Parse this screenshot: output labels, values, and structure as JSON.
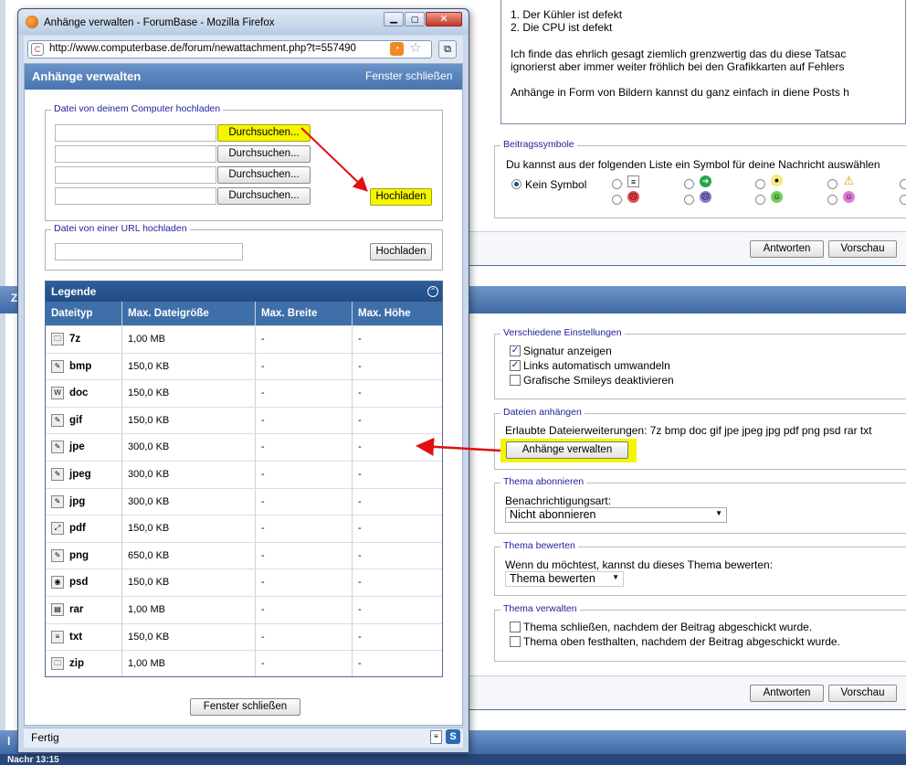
{
  "background_page": {
    "post_lines": [
      "1. Der Kühler ist defekt",
      "2. Die CPU ist defekt",
      "Ich finde das ehrlich gesagt ziemlich grenzwertig das du diese Tatsac",
      "ignorierst aber immer weiter fröhlich bei den Grafikkarten auf Fehlers",
      "Anhänge in Form von Bildern kannst du ganz einfach in diene Posts h"
    ],
    "beitragssymbole": {
      "legend": "Beitragssymbole",
      "text": "Du kannst aus der folgenden Liste ein Symbol für deine Nachricht auswählen",
      "none_label": "Kein Symbol"
    },
    "reply_button": "Antworten",
    "preview_button": "Vorschau",
    "section_letter": "Z",
    "verschiedene": {
      "legend": "Verschiedene Einstellungen",
      "items": [
        {
          "label": "Signatur anzeigen",
          "checked": "✓"
        },
        {
          "label": "Links automatisch umwandeln",
          "checked": "✓"
        },
        {
          "label": "Grafische Smileys deaktivieren",
          "checked": ""
        }
      ]
    },
    "dateien": {
      "legend": "Dateien anhängen",
      "text": "Erlaubte Dateierweiterungen: 7z bmp doc gif jpe jpeg jpg pdf png psd rar txt",
      "button": "Anhänge verwalten"
    },
    "abonnieren": {
      "legend": "Thema abonnieren",
      "label": "Benachrichtigungsart:",
      "value": "Nicht abonnieren"
    },
    "bewerten": {
      "legend": "Thema bewerten",
      "label": "Wenn du möchtest, kannst du dieses Thema bewerten:",
      "value": "Thema bewerten"
    },
    "verwalten": {
      "legend": "Thema verwalten",
      "items": [
        "Thema schließen, nachdem der Beitrag abgeschickt wurde.",
        "Thema oben festhalten, nachdem der Beitrag abgeschickt wurde."
      ]
    },
    "bottom_letter": "l",
    "bottom_text": "Nachr 13:15"
  },
  "popup": {
    "window_title": "Anhänge verwalten - ForumBase - Mozilla Firefox",
    "url": "http://www.computerbase.de/forum/newattachment.php?t=557490",
    "header_title": "Anhänge verwalten",
    "close_link": "Fenster schließen",
    "upload_local": {
      "legend": "Datei von deinem Computer hochladen",
      "browse_label": "Durchsuchen...",
      "upload_label": "Hochladen"
    },
    "upload_url": {
      "legend": "Datei von einer URL hochladen",
      "upload_label": "Hochladen"
    },
    "legende": {
      "title": "Legende",
      "columns": [
        "Dateityp",
        "Max. Dateigröße",
        "Max. Breite",
        "Max. Höhe"
      ],
      "rows": [
        {
          "type": "7z",
          "size": "1,00 MB",
          "width": "-",
          "height": "-",
          "icon": "archive-icon"
        },
        {
          "type": "bmp",
          "size": "150,0 KB",
          "width": "-",
          "height": "-",
          "icon": "image-icon"
        },
        {
          "type": "doc",
          "size": "150,0 KB",
          "width": "-",
          "height": "-",
          "icon": "word-icon"
        },
        {
          "type": "gif",
          "size": "150,0 KB",
          "width": "-",
          "height": "-",
          "icon": "image-icon"
        },
        {
          "type": "jpe",
          "size": "300,0 KB",
          "width": "-",
          "height": "-",
          "icon": "image-icon"
        },
        {
          "type": "jpeg",
          "size": "300,0 KB",
          "width": "-",
          "height": "-",
          "icon": "image-icon"
        },
        {
          "type": "jpg",
          "size": "300,0 KB",
          "width": "-",
          "height": "-",
          "icon": "image-icon"
        },
        {
          "type": "pdf",
          "size": "150,0 KB",
          "width": "-",
          "height": "-",
          "icon": "pdf-icon"
        },
        {
          "type": "png",
          "size": "650,0 KB",
          "width": "-",
          "height": "-",
          "icon": "image-icon"
        },
        {
          "type": "psd",
          "size": "150,0 KB",
          "width": "-",
          "height": "-",
          "icon": "psd-icon"
        },
        {
          "type": "rar",
          "size": "1,00 MB",
          "width": "-",
          "height": "-",
          "icon": "rar-icon"
        },
        {
          "type": "txt",
          "size": "150,0 KB",
          "width": "-",
          "height": "-",
          "icon": "text-icon"
        },
        {
          "type": "zip",
          "size": "1,00 MB",
          "width": "-",
          "height": "-",
          "icon": "archive-icon"
        }
      ]
    },
    "close_button": "Fenster schließen",
    "status": "Fertig"
  },
  "colors": {
    "highlight": "#f5f500",
    "arrow": "#e01010",
    "header_blue": "#4f7ebb",
    "table_header": "#3f6fa8",
    "legend_text": "#22229c"
  }
}
